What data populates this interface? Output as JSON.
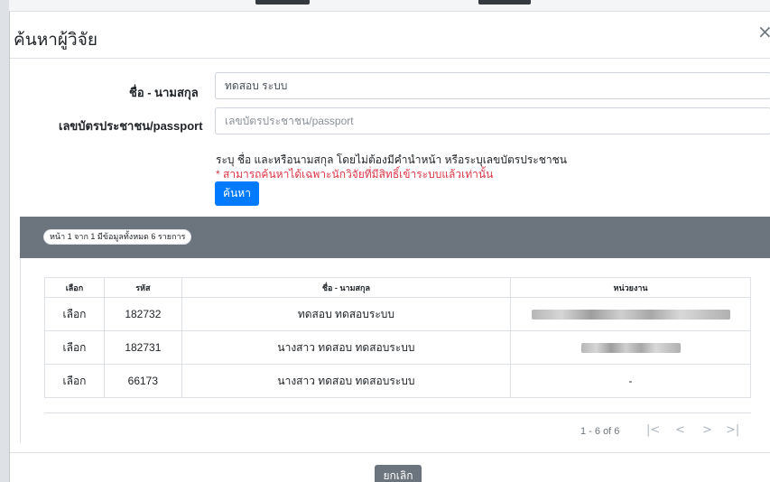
{
  "modal": {
    "title": "ค้นหาผู้วิจัย",
    "close_symbol": "×"
  },
  "form": {
    "name_label": "ชื่อ - นามสกุล",
    "name_value": "ทดสอบ ระบบ",
    "id_label": "เลขบัตรประชาชน/passport",
    "id_placeholder": "เลขบัตรประชาชน/passport",
    "hint": "ระบุ ชื่อ และหรือนามสกุล โดยไม่ต้องมีคำนำหน้า หรือระบุเลขบัตรประชาชน",
    "warning": "* สามารถค้นหาได้เฉพาะนักวิจัยที่มีสิทธิ์เข้าระบบแล้วเท่านั้น",
    "search_button": "ค้นหา"
  },
  "results": {
    "summary": "หน้า 1 จาก 1 มีข้อมูลทั้งหมด 6 รายการ",
    "columns": [
      "เลือก",
      "รหัส",
      "ชื่อ - นามสกุล",
      "หน่วยงาน"
    ],
    "rows": [
      {
        "action": "เลือก",
        "id": "182732",
        "name": "ทดสอบ ทดสอบระบบ",
        "org": ""
      },
      {
        "action": "เลือก",
        "id": "182731",
        "name": "นางสาว ทดสอบ ทดสอบระบบ",
        "org": ""
      },
      {
        "action": "เลือก",
        "id": "66173",
        "name": "นางสาว ทดสอบ ทดสอบระบบ",
        "org": "-"
      }
    ],
    "pagination": {
      "range": "1 - 6 of 6",
      "first": "|<",
      "prev": "<",
      "next": ">",
      "last": ">|"
    }
  },
  "footer": {
    "cancel_button": "ยกเลิก"
  },
  "colors": {
    "primary": "#007bff",
    "secondary": "#6c757d",
    "danger": "#dc3545"
  }
}
